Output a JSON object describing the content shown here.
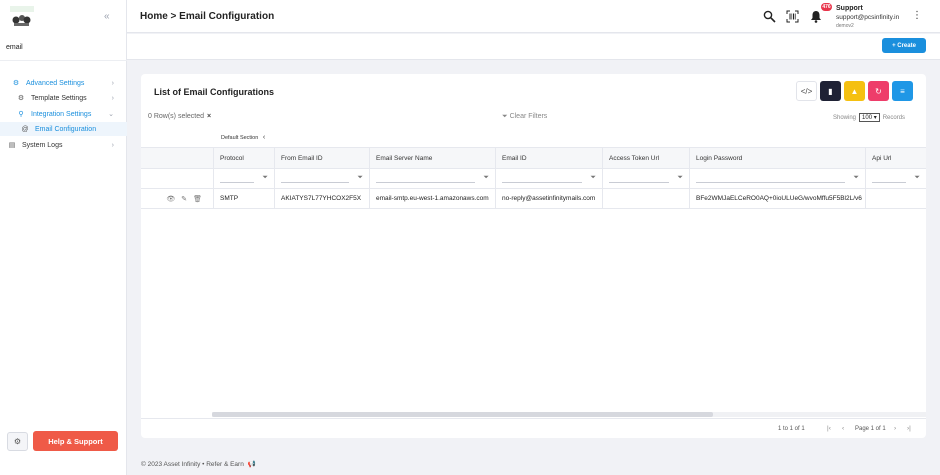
{
  "sidebar": {
    "search_value": "email",
    "items": [
      {
        "label": "Advanced Settings"
      },
      {
        "label": "Template Settings"
      },
      {
        "label": "Integration Settings"
      },
      {
        "label": "Email Configuration"
      },
      {
        "label": "System Logs"
      }
    ],
    "help_label": "Help & Support"
  },
  "header": {
    "breadcrumb": "Home > Email Configuration",
    "notification_count": "476",
    "user_name": "Support",
    "user_email": "support@pcsinfinity.in",
    "user_sub": "demov2"
  },
  "toolbar": {
    "create_label": "+ Create"
  },
  "card": {
    "title": "List of Email Configurations",
    "rows_selected": "0 Row(s) selected",
    "clear_filters": "Clear Filters",
    "showing_label": "Showing",
    "page_size": "100",
    "records_label": "Records",
    "default_section": "Default Section"
  },
  "table": {
    "columns": [
      "Protocol",
      "From Email ID",
      "Email Server Name",
      "Email ID",
      "Access Token Url",
      "Login Password",
      "Api Url"
    ],
    "rows": [
      [
        "SMTP",
        "AKIATYS7L77YHCOX2F5X",
        "email-smtp.eu-west-1.amazonaws.com",
        "no-reply@assetinfinitymails.com",
        "",
        "BFe2WMJaELCeRO0AQ+0ioULUeG/wvoMffu5F5Bl2L/v6",
        ""
      ]
    ]
  },
  "pagination": {
    "range": "1 to 1 of 1",
    "page_text": "Page 1 of 1"
  },
  "footer": {
    "copyright": "© 2023  Asset Infinity • Refer & Earn"
  },
  "colors": {
    "accent": "#1a8fdd",
    "help": "#ef5a47",
    "btn_dark": "#1f2235",
    "btn_yellow": "#f5c010",
    "btn_pink": "#ee3d6a",
    "btn_blue": "#1f97e6",
    "badge": "#e8344a"
  }
}
